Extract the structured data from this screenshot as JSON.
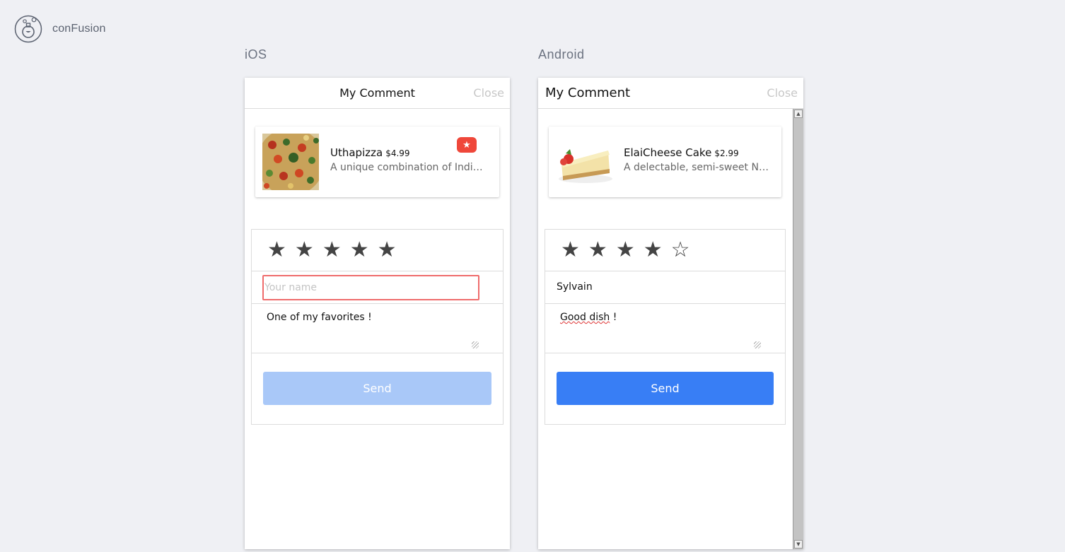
{
  "app": {
    "brand": "conFusion"
  },
  "icons": {
    "logo": "flask-logo-icon",
    "favorite": "star-icon",
    "star_filled": "★",
    "star_empty": "☆"
  },
  "colors": {
    "background": "#eff0f4",
    "send_active": "#387ef5",
    "send_disabled": "#a9c8f8",
    "favorite_badge": "#ef473a",
    "invalid_border": "#ef6c6c"
  },
  "ios": {
    "platform_label": "iOS",
    "modal": {
      "title": "My Comment",
      "close_label": "Close"
    },
    "dish": {
      "name": "Uthapizza",
      "price": "$4.99",
      "description": "A unique combination of Indian Uthappam (pancake) and Italian pizza",
      "favorite_badge": "★"
    },
    "rating": 5,
    "stars": [
      "★",
      "★",
      "★",
      "★",
      "★"
    ],
    "name_field": {
      "value": "",
      "placeholder": "Your name"
    },
    "comment": "One of my favorites !",
    "send_label": "Send",
    "send_enabled": false
  },
  "android": {
    "platform_label": "Android",
    "modal": {
      "title": "My Comment",
      "close_label": "Close"
    },
    "dish": {
      "name": "ElaiCheese Cake",
      "price": "$2.99",
      "description": "A delectable, semi-sweet New York Style Cheese Cake"
    },
    "rating": 4,
    "stars": [
      "★",
      "★",
      "★",
      "★",
      "☆"
    ],
    "name_field": {
      "value": "Sylvain"
    },
    "comment_underlined": "Good dish",
    "comment_rest": " !",
    "send_label": "Send",
    "send_enabled": true
  }
}
